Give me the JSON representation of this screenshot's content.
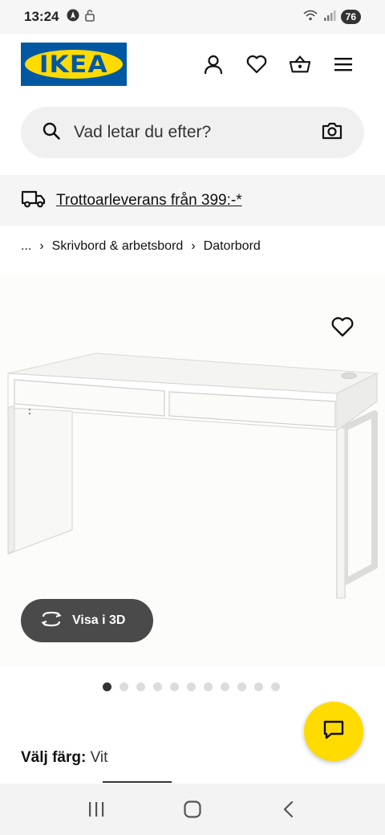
{
  "status_bar": {
    "time": "13:24",
    "battery": "76",
    "icons": [
      "navigation-icon",
      "lock-icon",
      "wifi-icon",
      "signal-icon"
    ]
  },
  "header": {
    "logo_text": "IKEA",
    "icons": [
      "user-icon",
      "heart-icon",
      "basket-icon",
      "menu-icon"
    ],
    "brand_blue": "#0058a3",
    "brand_yellow": "#ffdb00"
  },
  "search": {
    "placeholder": "Vad letar du efter?"
  },
  "promo": {
    "text": "Trottoarleverans från 399:-*"
  },
  "breadcrumb": {
    "ellipsis": "...",
    "items": [
      "Skrivbord & arbetsbord",
      "Datorbord"
    ]
  },
  "product": {
    "view_3d_label": "Visa i 3D",
    "carousel_count": 11,
    "carousel_active_index": 0,
    "color_label": "Välj färg:",
    "color_value": "Vit"
  }
}
